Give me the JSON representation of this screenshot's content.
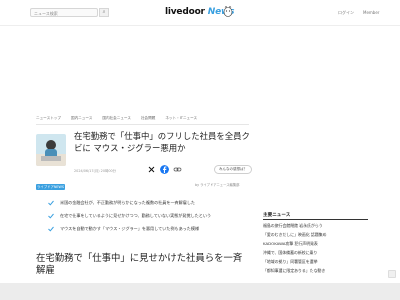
{
  "header": {
    "search_placeholder": "ニュース検索",
    "search_button": "⌕",
    "logo_main": "livedoor",
    "logo_news": "News",
    "login": "ログイン",
    "member": "Member"
  },
  "breadcrumbs": [
    "ニューストップ",
    "国内ニュース",
    "国内社会ニュース",
    "社会問題",
    "ネット・ITニュース"
  ],
  "article": {
    "title": "在宅勤務で「仕事中」のフリした社員を全員クビに マウス・ジグラー悪用か",
    "date": "2024/06/17(月) 20時00分",
    "share_label": "みんなの感想は？",
    "source": "by ライブドアニュース編集部",
    "tag": "ライブドアNEWS",
    "points": [
      "米国の金融会社が、不正勤務が明らかになった複数の社員を一斉解雇した",
      "在宅で仕事をしているように見せかけつつ、勤務していない実態が発覚したという",
      "マウスを自動で動かす「マウス・ジグラー」を悪用していた例もあった模様"
    ],
    "heading": "在宅勤務で「仕事中」に見せかけた社員らを一斉解雇"
  },
  "sidebar": {
    "title": "主要ニュース",
    "items": [
      "福島の旅行会館閉館 岩永氏がらう",
      "「愛のむきだしに」映画化 話題集め",
      "KADOKAWA攻撃 犯行声明発表",
      "沖縄で、国体備蓄の新校に乗り",
      "「地域の拠り」同署管区を選挙",
      "「都知事選に限定ありる」たな動き"
    ]
  },
  "colors": {
    "accent": "#3aa0e0",
    "twitter": "#1da1f2",
    "facebook": "#1877f2"
  },
  "icons": [
    "search-icon",
    "mascot-icon",
    "x-icon",
    "facebook-icon",
    "link-icon",
    "check-icon"
  ]
}
